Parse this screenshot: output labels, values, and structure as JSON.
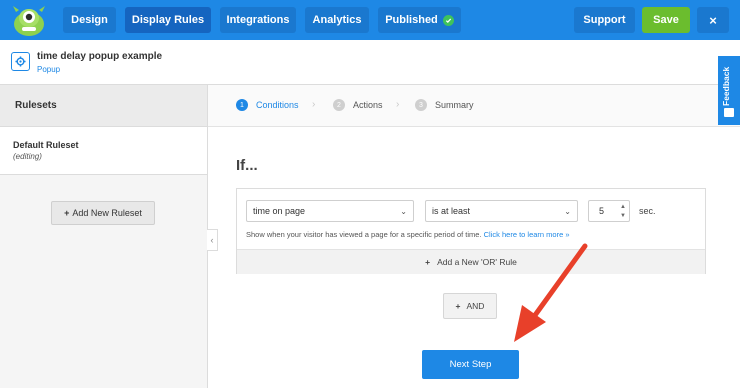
{
  "topnav": {
    "logo_icon": "monster-mascot-icon",
    "tabs": [
      {
        "label": "Design"
      },
      {
        "label": "Display Rules",
        "active": true
      },
      {
        "label": "Integrations"
      },
      {
        "label": "Analytics"
      },
      {
        "label": "Published",
        "icon": "check-circle-icon"
      }
    ],
    "support_label": "Support",
    "save_label": "Save",
    "close_label": "×"
  },
  "campaign": {
    "icon": "gear-icon",
    "title": "time delay popup example",
    "type": "Popup"
  },
  "sidebar": {
    "heading": "Rulesets",
    "rulesets": [
      {
        "name": "Default Ruleset",
        "status": "(editing)"
      }
    ],
    "add_label": "Add New Ruleset"
  },
  "stepper": {
    "steps": [
      {
        "num": "1",
        "label": "Conditions",
        "active": true
      },
      {
        "num": "2",
        "label": "Actions"
      },
      {
        "num": "3",
        "label": "Summary"
      }
    ]
  },
  "main": {
    "heading": "If...",
    "rule": {
      "condition": "time on page",
      "operator": "is at least",
      "value": "5",
      "unit": "sec.",
      "help_text": "Show when your visitor has viewed a page for a specific period of time.",
      "help_link": "Click here to learn more »"
    },
    "add_or_label": "Add a New 'OR' Rule",
    "and_label": "AND",
    "next_label": "Next Step"
  },
  "feedback": {
    "label": "Feedback"
  },
  "colors": {
    "primary": "#1e88e5",
    "save": "#6bbd2e",
    "published_check": "#3fc35b",
    "annotation_arrow": "#e8402a"
  }
}
